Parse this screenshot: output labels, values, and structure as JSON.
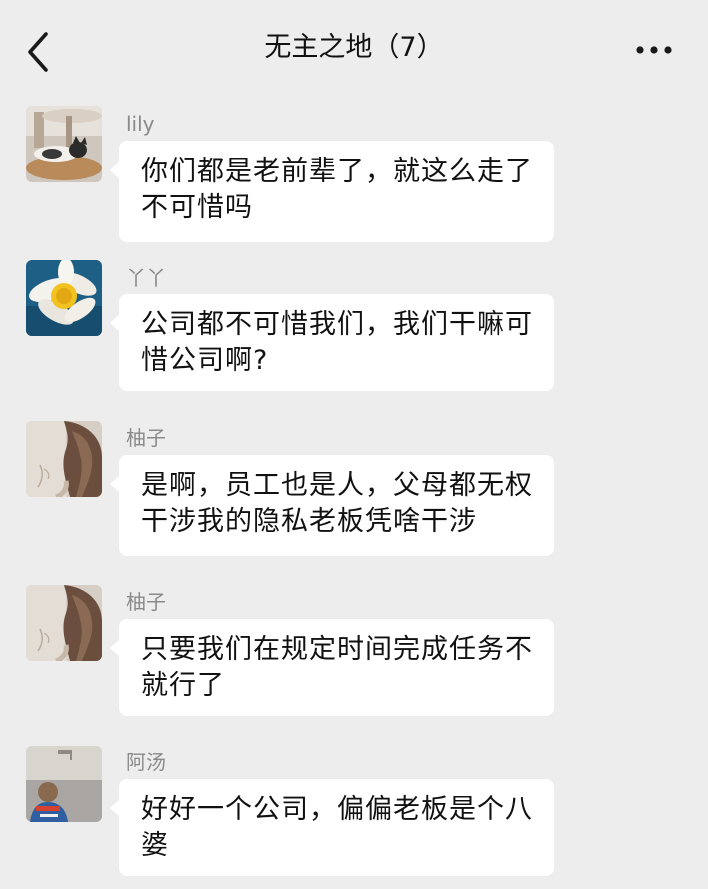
{
  "header": {
    "title": "无主之地（7）",
    "back_icon": "chevron-left-icon",
    "more_icon": "more-dots-icon"
  },
  "messages": [
    {
      "sender": "lily",
      "avatar": "cat-on-cushion-avatar",
      "text": "你们都是老前辈了，就这么走了不可惜吗"
    },
    {
      "sender": "丫丫",
      "avatar": "daffodil-avatar",
      "text": "公司都不可惜我们，我们干嘛可惜公司啊?"
    },
    {
      "sender": "柚子",
      "avatar": "girl-hair-avatar",
      "text": "是啊，员工也是人，父母都无权干涉我的隐私老板凭啥干涉"
    },
    {
      "sender": "柚子",
      "avatar": "girl-hair-avatar",
      "text": "只要我们在规定时间完成任务不就行了"
    },
    {
      "sender": "阿汤",
      "avatar": "child-by-sea-avatar",
      "text": "好好一个公司，偏偏老板是个八婆"
    }
  ]
}
